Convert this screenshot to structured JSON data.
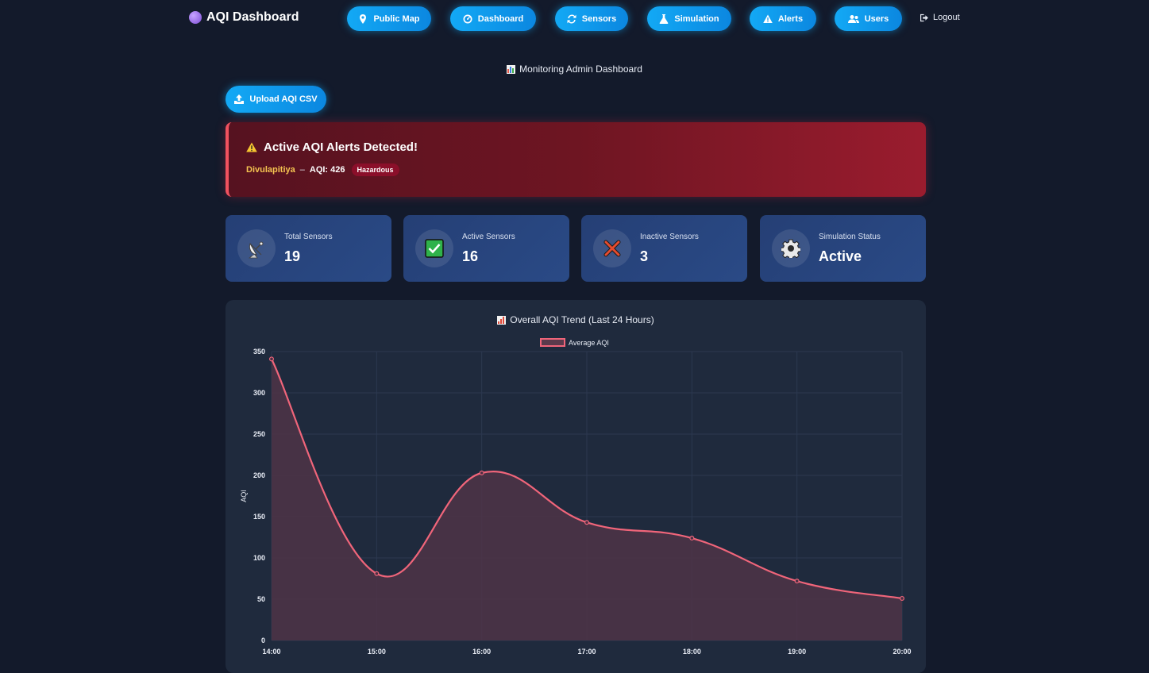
{
  "navbar": {
    "brand": "AQI Dashboard",
    "items": [
      {
        "label": "Public Map",
        "icon": "map-pin-icon"
      },
      {
        "label": "Dashboard",
        "icon": "dashboard-gauge-icon"
      },
      {
        "label": "Sensors",
        "icon": "sync-icon"
      },
      {
        "label": "Simulation",
        "icon": "flask-icon"
      },
      {
        "label": "Alerts",
        "icon": "warning-icon"
      },
      {
        "label": "Users",
        "icon": "users-icon"
      }
    ],
    "logout": "Logout"
  },
  "page": {
    "title": "Monitoring Admin Dashboard"
  },
  "upload": {
    "label": "Upload AQI CSV"
  },
  "alert": {
    "title": "Active AQI Alerts Detected!",
    "location": "Divulapitiya",
    "separator": "–",
    "aqi_text": "AQI: 426",
    "badge": "Hazardous"
  },
  "cards": [
    {
      "label": "Total Sensors",
      "value": "19",
      "icon": "satellite-dish-icon"
    },
    {
      "label": "Active Sensors",
      "value": "16",
      "icon": "check-box-icon"
    },
    {
      "label": "Inactive Sensors",
      "value": "3",
      "icon": "cross-icon"
    },
    {
      "label": "Simulation Status",
      "value": "Active",
      "icon": "gear-icon"
    }
  ],
  "colors": {
    "accent": "#13a9f5",
    "line": "#f0657a",
    "fill": "#4f3447",
    "alert_gradient_end": "#9a1c2e",
    "card": "#27457d"
  },
  "chart_data": {
    "type": "area",
    "title": "Overall AQI Trend (Last 24 Hours)",
    "ylabel": "AQI",
    "x": [
      "14:00",
      "15:00",
      "16:00",
      "17:00",
      "18:00",
      "19:00",
      "20:00"
    ],
    "series": [
      {
        "name": "Average AQI",
        "values": [
          341,
          81,
          203,
          143,
          124,
          72,
          51
        ]
      }
    ],
    "ylim": [
      0,
      350
    ],
    "yticks": [
      0,
      50,
      100,
      150,
      200,
      250,
      300,
      350
    ],
    "grid": true,
    "legend": "top-center"
  }
}
